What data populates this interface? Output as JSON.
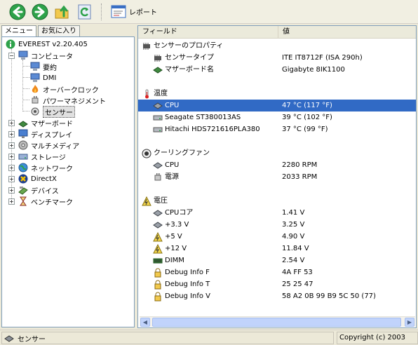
{
  "toolbar": {
    "back_icon": "back-arrow-icon",
    "forward_icon": "forward-arrow-icon",
    "up_icon": "up-folder-icon",
    "refresh_icon": "refresh-icon",
    "report_label": "レポート"
  },
  "left": {
    "tabs": [
      "メニュー",
      "お気に入り"
    ],
    "tree": [
      {
        "label": "EVEREST v2.20.405",
        "icon": "info-icon",
        "level": 0
      },
      {
        "label": "コンピュータ",
        "icon": "computer-icon",
        "level": 1
      },
      {
        "label": "要約",
        "icon": "computer-icon",
        "level": 2
      },
      {
        "label": "DMI",
        "icon": "computer-icon",
        "level": 2
      },
      {
        "label": "オーバークロック",
        "icon": "flame-icon",
        "level": 2
      },
      {
        "label": "パワーマネジメント",
        "icon": "power-plug-icon",
        "level": 2
      },
      {
        "label": "センサー",
        "icon": "sensor-icon",
        "level": 2
      },
      {
        "label": "マザーボード",
        "icon": "motherboard-icon",
        "level": 1
      },
      {
        "label": "ディスプレイ",
        "icon": "display-icon",
        "level": 1
      },
      {
        "label": "マルチメディア",
        "icon": "multimedia-icon",
        "level": 1
      },
      {
        "label": "ストレージ",
        "icon": "storage-icon",
        "level": 1
      },
      {
        "label": "ネットワーク",
        "icon": "network-icon",
        "level": 1
      },
      {
        "label": "DirectX",
        "icon": "directx-icon",
        "level": 1
      },
      {
        "label": "デバイス",
        "icon": "devices-icon",
        "level": 1
      },
      {
        "label": "ベンチマーク",
        "icon": "hourglass-icon",
        "level": 1
      }
    ]
  },
  "right": {
    "columns": [
      "フィールド",
      "値"
    ],
    "rows": [
      {
        "type": "group",
        "field": "センサーのプロパティ",
        "value": "",
        "icon": "chip-icon"
      },
      {
        "type": "item",
        "field": "センサータイプ",
        "value": "ITE IT8712F  (ISA 290h)",
        "icon": "chip-icon"
      },
      {
        "type": "item",
        "field": "マザーボード名",
        "value": "Gigabyte 8IK1100",
        "icon": "motherboard-icon"
      },
      {
        "type": "spacer"
      },
      {
        "type": "group",
        "field": "温度",
        "value": "",
        "icon": "thermometer-icon"
      },
      {
        "type": "item",
        "field": "CPU",
        "value": "47 °C  (117 °F)",
        "icon": "cpu-icon",
        "selected": true
      },
      {
        "type": "item",
        "field": "Seagate ST380013AS",
        "value": "39 °C  (102 °F)",
        "icon": "hdd-icon"
      },
      {
        "type": "item",
        "field": "Hitachi HDS721616PLA380",
        "value": "37 °C  (99 °F)",
        "icon": "hdd-icon"
      },
      {
        "type": "spacer"
      },
      {
        "type": "group",
        "field": "クーリングファン",
        "value": "",
        "icon": "fan-icon"
      },
      {
        "type": "item",
        "field": "CPU",
        "value": "2280 RPM",
        "icon": "cpu-icon"
      },
      {
        "type": "item",
        "field": "電源",
        "value": "2033 RPM",
        "icon": "power-plug-icon"
      },
      {
        "type": "spacer"
      },
      {
        "type": "group",
        "field": "電圧",
        "value": "",
        "icon": "voltage-icon"
      },
      {
        "type": "item",
        "field": "CPUコア",
        "value": "1.41 V",
        "icon": "cpu-icon"
      },
      {
        "type": "item",
        "field": "+3.3 V",
        "value": "3.25 V",
        "icon": "cpu-icon"
      },
      {
        "type": "item",
        "field": "+5 V",
        "value": "4.90 V",
        "icon": "voltage-icon"
      },
      {
        "type": "item",
        "field": "+12 V",
        "value": "11.84 V",
        "icon": "voltage-icon"
      },
      {
        "type": "item",
        "field": "DIMM",
        "value": "2.54 V",
        "icon": "dimm-icon"
      },
      {
        "type": "item",
        "field": "Debug Info F",
        "value": "4A FF 53",
        "icon": "debug-icon"
      },
      {
        "type": "item",
        "field": "Debug Info T",
        "value": "25 25 47",
        "icon": "debug-icon"
      },
      {
        "type": "item",
        "field": "Debug Info V",
        "value": "58 A2 0B 99 B9 5C 50 (77)",
        "icon": "debug-icon"
      }
    ]
  },
  "status": {
    "left_label": "センサー",
    "right_label": "Copyright (c) 2003",
    "left_icon": "sensor-icon"
  }
}
